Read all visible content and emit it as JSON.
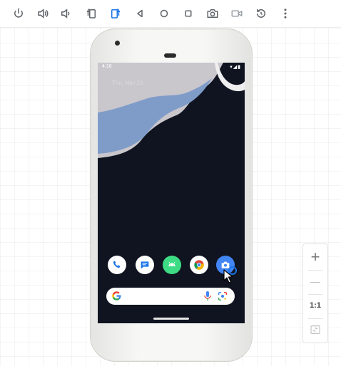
{
  "toolbar": {
    "buttons": [
      {
        "icon": "power-icon"
      },
      {
        "icon": "volume-up-icon"
      },
      {
        "icon": "volume-down-icon"
      },
      {
        "icon": "rotate-left-icon"
      },
      {
        "icon": "rotate-right-icon"
      },
      {
        "icon": "back-icon"
      },
      {
        "icon": "home-icon"
      },
      {
        "icon": "overview-icon"
      },
      {
        "icon": "screenshot-camera-icon"
      },
      {
        "icon": "screen-record-icon"
      },
      {
        "icon": "reset-icon"
      },
      {
        "icon": "more-vert-icon"
      }
    ]
  },
  "status_bar": {
    "time": "4:16",
    "icons": "▾◢▮"
  },
  "home": {
    "date": "Thu, Nov 23",
    "dock": [
      {
        "name": "Phone",
        "icon": "phone-icon"
      },
      {
        "name": "Messages",
        "icon": "messages-icon"
      },
      {
        "name": "Android",
        "icon": "android-icon"
      },
      {
        "name": "Chrome",
        "icon": "chrome-icon"
      },
      {
        "name": "Camera",
        "icon": "camera-icon"
      }
    ],
    "search": {
      "icons": [
        "google-g-icon",
        "mic-icon",
        "lens-icon"
      ]
    }
  },
  "zoom": {
    "plus": "+",
    "minus": "—",
    "actual_size_label": "1:1",
    "fit_icon": "fit-screen-icon"
  },
  "colors": {
    "toolbar_icon": "#5f6368",
    "wallpaper_dark": "#0f1420",
    "wallpaper_blue": "#7f9cc9",
    "accent": "#1a73e8"
  }
}
